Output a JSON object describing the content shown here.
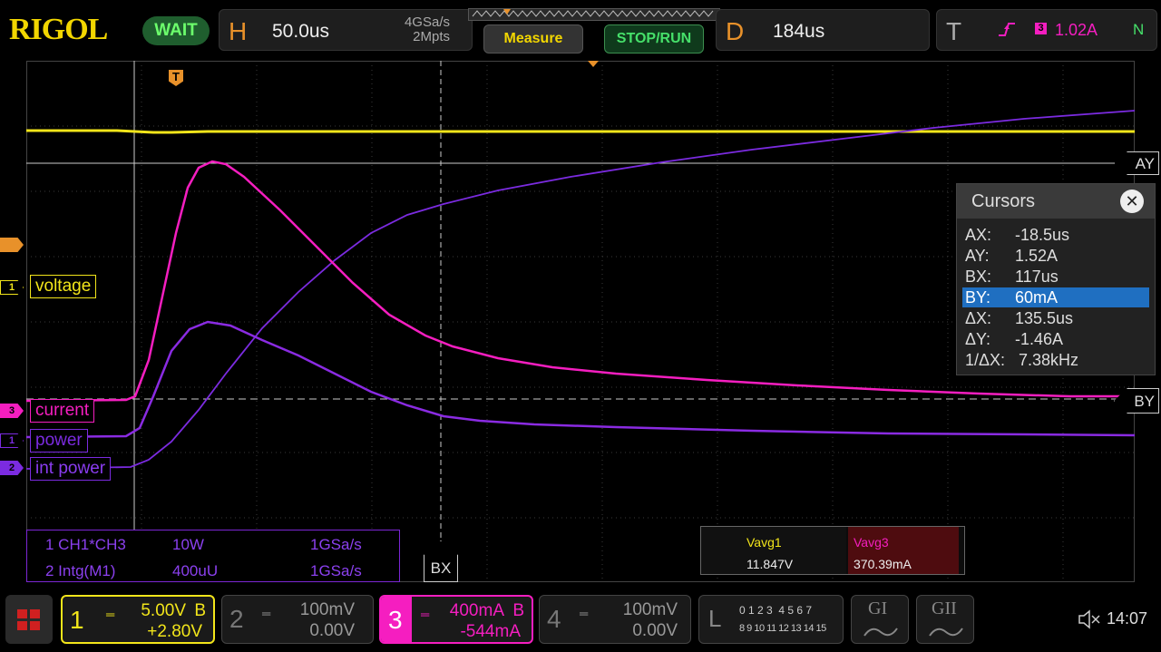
{
  "brand": "RIGOL",
  "status": "WAIT",
  "horizontal": {
    "letter": "H",
    "timebase": "50.0us",
    "sample_rate": "4GSa/s",
    "memory_depth": "2Mpts"
  },
  "buttons": {
    "measure": "Measure",
    "stop_run": "STOP/RUN"
  },
  "delay": {
    "letter": "D",
    "value": "184us"
  },
  "trigger": {
    "letter": "T",
    "source": "3",
    "level": "1.02A",
    "mode": "N"
  },
  "trigger_marker": "T",
  "cursor_labels": {
    "ay": "AY",
    "by": "BY",
    "bx": "BX"
  },
  "channel_labels": {
    "voltage": "voltage",
    "current": "current",
    "power": "power",
    "int_power": "int power"
  },
  "channel_markers": {
    "ch1": "1",
    "ch3": "3",
    "m1": "1",
    "m2": "2"
  },
  "cursors_panel": {
    "title": "Cursors",
    "rows": [
      {
        "key": "AX:",
        "value": "-18.5us"
      },
      {
        "key": "AY:",
        "value": "1.52A"
      },
      {
        "key": "BX:",
        "value": "117us"
      },
      {
        "key": "BY:",
        "value": "60mA",
        "selected": true
      },
      {
        "key": "ΔX:",
        "value": "135.5us"
      },
      {
        "key": "ΔY:",
        "value": "-1.46A"
      },
      {
        "key": "1/ΔX:",
        "value": "7.38kHz"
      }
    ]
  },
  "math": [
    {
      "label": "1 CH1*CH3",
      "scale": "10W",
      "rate": "1GSa/s"
    },
    {
      "label": "2 Intg(M1)",
      "scale": "400uU",
      "rate": "1GSa/s"
    }
  ],
  "measurements": [
    {
      "name": "Vavg1",
      "value": "11.847V"
    },
    {
      "name": "Vavg3",
      "value": "370.39mA"
    }
  ],
  "channels": [
    {
      "num": "1",
      "scale": "5.00V",
      "coupling": "B",
      "offset": "+2.80V",
      "color": "#f2e51a",
      "active": true
    },
    {
      "num": "2",
      "scale": "100mV",
      "coupling": "",
      "offset": "0.00V",
      "color": "#888888",
      "active": false
    },
    {
      "num": "3",
      "scale": "400mA",
      "coupling": "B",
      "offset": "-544mA",
      "color": "#f51ec0",
      "active": true
    },
    {
      "num": "4",
      "scale": "100mV",
      "coupling": "",
      "offset": "0.00V",
      "color": "#888888",
      "active": false
    }
  ],
  "logic": {
    "letter": "L",
    "row1": "0 1 2 3  4 5 6 7",
    "row2": "8 9 10 11 12 13 14 15"
  },
  "decoders": {
    "g1": "GI",
    "g2": "GII"
  },
  "clock": "14:07",
  "colors": {
    "ch1": "#f2e51a",
    "ch3": "#f51ec0",
    "math": "#8a2be2",
    "accent": "#e8912a",
    "selected": "#1f6fc1"
  }
}
